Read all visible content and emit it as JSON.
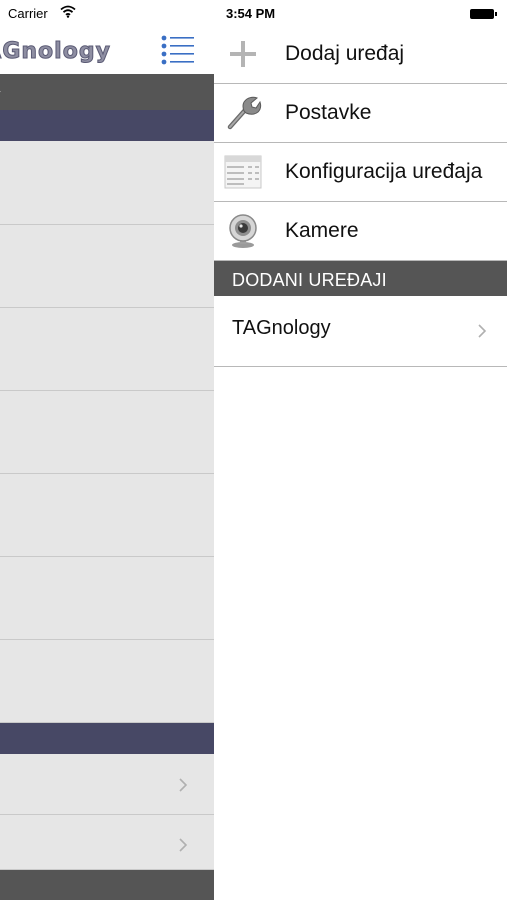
{
  "left_panel": {
    "status": {
      "carrier": "Carrier"
    },
    "nav": {
      "brand": "TAGnology"
    },
    "header_fragment": "y"
  },
  "right_panel": {
    "status": {
      "time": "3:54 PM"
    },
    "menu_items": [
      {
        "label": "Dodaj uređaj",
        "icon": "plus-icon"
      },
      {
        "label": "Postavke",
        "icon": "wrench-icon"
      },
      {
        "label": "Konfiguracija uređaja",
        "icon": "spreadsheet-icon"
      },
      {
        "label": "Kamere",
        "icon": "webcam-icon"
      }
    ],
    "section_header": "DODANI UREĐAJI",
    "devices": [
      {
        "label": "TAGnology"
      }
    ]
  },
  "colors": {
    "section_header": "#555555",
    "navy_bar": "#474865",
    "row_bg": "#e6e6e6",
    "menu_icon_blue": "#3a6fc4"
  }
}
